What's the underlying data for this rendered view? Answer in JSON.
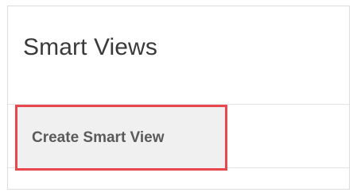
{
  "panel": {
    "title": "Smart Views",
    "create_button_label": "Create Smart View",
    "highlight_color": "#e8474e"
  }
}
